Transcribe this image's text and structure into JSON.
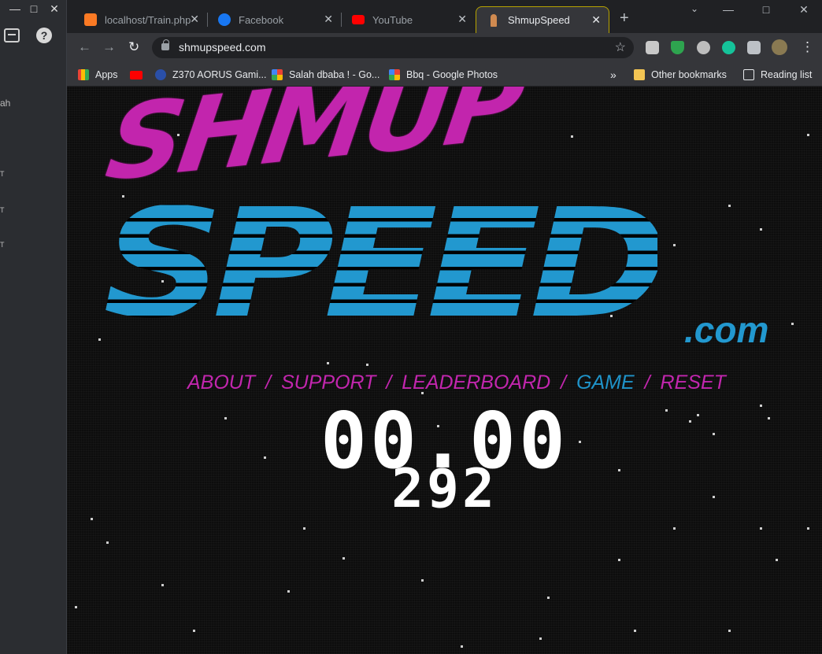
{
  "left_app": {
    "fragments": [
      "ah",
      "T",
      "T",
      "T"
    ]
  },
  "browser": {
    "tabs": [
      {
        "title": "localhost/Train.php",
        "icon": "xampp-icon",
        "color": "#fb7a24"
      },
      {
        "title": "Facebook",
        "icon": "facebook-icon",
        "color": "#1877f2"
      },
      {
        "title": "YouTube",
        "icon": "youtube-icon",
        "color": "#ff0000"
      },
      {
        "title": "ShmupSpeed",
        "icon": "rocket-icon",
        "color": "#d08a50"
      }
    ],
    "address": "shmupspeed.com",
    "bookmarks": {
      "apps": "Apps",
      "items": [
        {
          "label": "Z370 AORUS Gami...",
          "icon": "aorus-icon"
        },
        {
          "label": "Salah dbaba ! - Go...",
          "icon": "google-photos-icon"
        },
        {
          "label": "Bbq - Google Photos",
          "icon": "google-photos-icon"
        }
      ],
      "overflow": "»",
      "other": "Other bookmarks",
      "reading": "Reading list"
    }
  },
  "site": {
    "logo_top": "SHMUP",
    "logo_bottom": "SPEED",
    "logo_suffix": ".com",
    "menu": {
      "about": "ABOUT",
      "support": "SUPPORT",
      "leaderboard": "LEADERBOARD",
      "game": "GAME",
      "reset": "RESET",
      "separator": "/"
    },
    "timer": "00.00",
    "count": "292",
    "colors": {
      "magenta": "#c226ae",
      "blue": "#1f93c9"
    }
  }
}
